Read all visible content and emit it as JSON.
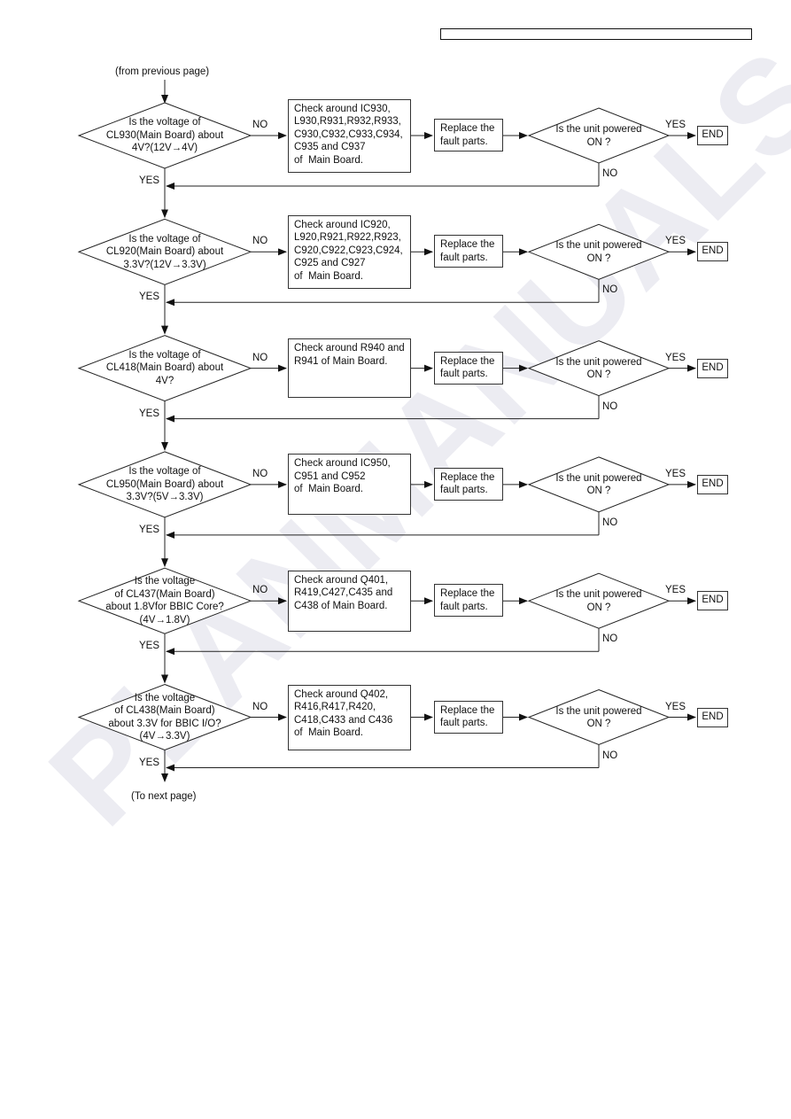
{
  "page": {
    "header_box_text": "",
    "from_previous": "(from previous page)",
    "to_next": "(To next page)",
    "watermark_text": "PLANMANUALS.COM"
  },
  "labels": {
    "yes": "YES",
    "no": "NO"
  },
  "common": {
    "replace_box": "Replace the\nfault parts.",
    "powered_question": "Is the unit powered\nON ?",
    "end": "END"
  },
  "rows": [
    {
      "question": "Is the voltage of\nCL930(Main Board) about\n4V?(12V→4V)",
      "check": "Check around IC930,\nL930,R931,R932,R933,\nC930,C932,C933,C934,\nC935 and C937\nof  Main Board."
    },
    {
      "question": "Is the voltage of\nCL920(Main Board) about\n3.3V?(12V→3.3V)",
      "check": "Check around IC920,\nL920,R921,R922,R923,\nC920,C922,C923,C924,\nC925 and C927\nof  Main Board."
    },
    {
      "question": "Is the voltage of\nCL418(Main Board) about\n4V?",
      "check": "Check around R940 and\nR941 of Main Board."
    },
    {
      "question": "Is the voltage of\nCL950(Main Board) about\n3.3V?(5V→3.3V)",
      "check": "Check around IC950,\nC951 and C952\nof  Main Board."
    },
    {
      "question": "Is the voltage\nof CL437(Main Board)\nabout 1.8Vfor BBIC Core?\n(4V→1.8V)",
      "check": "Check around Q401,\nR419,C427,C435 and\nC438 of Main Board."
    },
    {
      "question": "Is the voltage\nof CL438(Main Board)\nabout 3.3V for BBIC I/O?\n(4V→3.3V)",
      "check": "Check around Q402,\nR416,R417,R420,\nC418,C433 and C436\nof  Main Board."
    }
  ]
}
